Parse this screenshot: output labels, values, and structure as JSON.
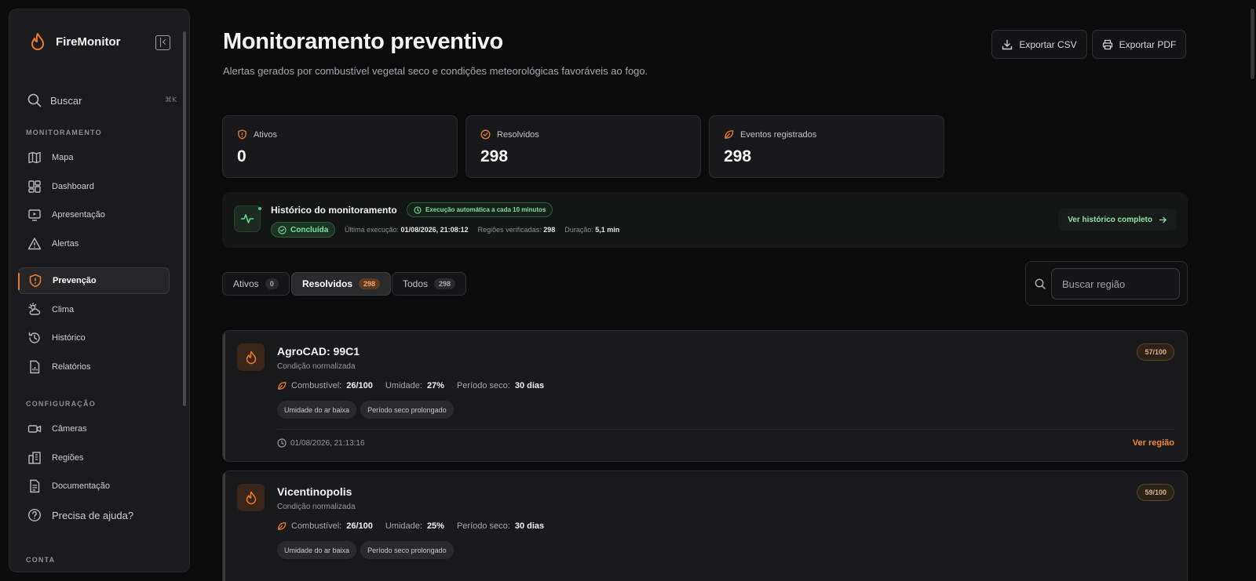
{
  "app": {
    "name": "FireMonitor"
  },
  "sidebar": {
    "search": {
      "label": "Buscar",
      "shortcut": "⌘K"
    },
    "sections": [
      {
        "title": "MONITORAMENTO"
      },
      {
        "title": "CONFIGURAÇÃO"
      },
      {
        "title": "CONTA"
      }
    ],
    "items": [
      {
        "label": "Mapa",
        "icon": "map-icon"
      },
      {
        "label": "Dashboard",
        "icon": "dashboard-icon"
      },
      {
        "label": "Apresentação",
        "icon": "presentation-icon"
      },
      {
        "label": "Alertas",
        "icon": "alert-triangle-icon"
      },
      {
        "label": "Prevenção",
        "icon": "shield-alert-icon",
        "active": true
      },
      {
        "label": "Clima",
        "icon": "cloud-sun-icon"
      },
      {
        "label": "Histórico",
        "icon": "history-icon"
      },
      {
        "label": "Relatórios",
        "icon": "report-icon"
      }
    ],
    "config_items": [
      {
        "label": "Câmeras",
        "icon": "camera-icon"
      },
      {
        "label": "Regiões",
        "icon": "building-icon"
      },
      {
        "label": "Documentação",
        "icon": "document-icon"
      }
    ],
    "help": {
      "label": "Precisa de ajuda?",
      "icon": "help-circle-icon"
    }
  },
  "header": {
    "title": "Monitoramento preventivo",
    "subtitle": "Alertas gerados por combustível vegetal seco e condições meteorológicas favoráveis ao fogo.",
    "export_csv": "Exportar CSV",
    "export_pdf": "Exportar PDF"
  },
  "stats": [
    {
      "label": "Ativos",
      "value": "0",
      "icon": "shield-icon"
    },
    {
      "label": "Resolvidos",
      "value": "298",
      "icon": "check-circle-icon"
    },
    {
      "label": "Eventos registrados",
      "value": "298",
      "icon": "leaf-icon"
    }
  ],
  "history": {
    "title": "Histórico do monitoramento",
    "auto_badge": "Execução automática a cada 10 minutos",
    "status": "Concluída",
    "last_run_label": "Última execução:",
    "last_run_value": "01/08/2026, 21:08:12",
    "regions_label": "Regiões verificadas:",
    "regions_value": "298",
    "duration_label": "Duração:",
    "duration_value": "5,1 min",
    "link": "Ver histórico completo"
  },
  "tabs": [
    {
      "label": "Ativos",
      "count": "0"
    },
    {
      "label": "Resolvidos",
      "count": "298",
      "active": true
    },
    {
      "label": "Todos",
      "count": "298"
    }
  ],
  "search": {
    "placeholder": "Buscar região"
  },
  "colors": {
    "accent": "#e8772e",
    "success": "#4fd07a",
    "background": "#0b0b0c"
  },
  "cards": [
    {
      "title": "AgroCAD: 99C1",
      "subtitle": "Condição normalizada",
      "score": "57/100",
      "fuel_label": "Combustível:",
      "fuel_value": "26/100",
      "humidity_label": "Umidade:",
      "humidity_value": "27%",
      "dry_label": "Período seco:",
      "dry_value": "30 dias",
      "tags": [
        "Umidade do ar baixa",
        "Período seco prolongado"
      ],
      "date": "01/08/2026, 21:13:16",
      "link": "Ver região"
    },
    {
      "title": "Vicentinopolis",
      "subtitle": "Condição normalizada",
      "score": "59/100",
      "fuel_label": "Combustível:",
      "fuel_value": "26/100",
      "humidity_label": "Umidade:",
      "humidity_value": "25%",
      "dry_label": "Período seco:",
      "dry_value": "30 dias",
      "tags": [
        "Umidade do ar baixa",
        "Período seco prolongado"
      ]
    }
  ]
}
